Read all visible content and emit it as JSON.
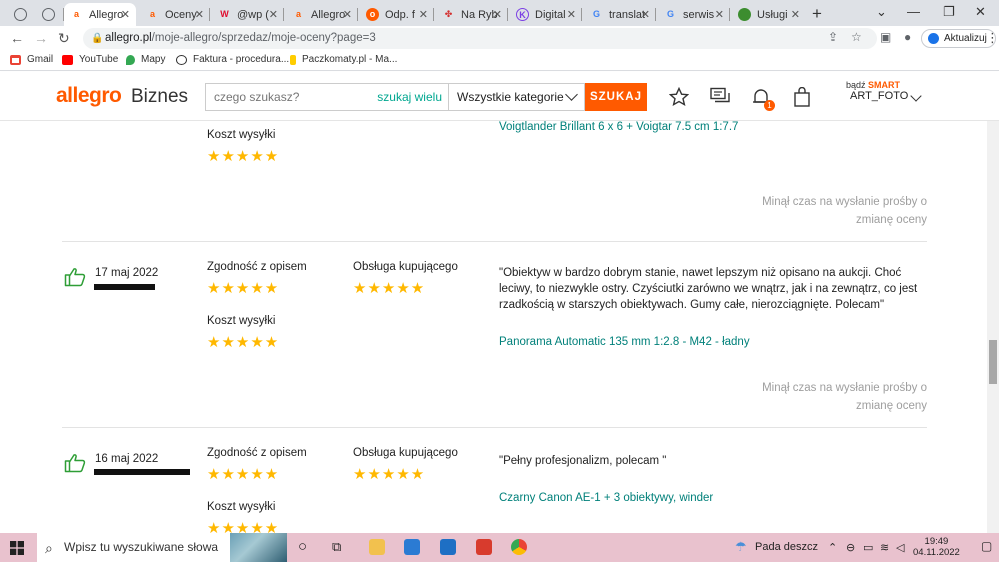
{
  "browser": {
    "tabs": [
      {
        "label": "",
        "icon": "chrome-icon",
        "color": "#5f6368"
      },
      {
        "label": "",
        "icon": "chrome-icon",
        "color": "#5f6368"
      },
      {
        "label": "Allegro",
        "icon": "allegro-icon",
        "color": "#ff5a00",
        "active": true
      },
      {
        "label": "Oceny",
        "icon": "allegro-icon",
        "color": "#ff5a00"
      },
      {
        "label": "@wp (",
        "icon": "wp-icon",
        "color": "#e10d2f"
      },
      {
        "label": "Allegro",
        "icon": "allegro-icon",
        "color": "#ff5a00"
      },
      {
        "label": "Odp. f",
        "icon": "odp-icon",
        "color": "#ff5a00"
      },
      {
        "label": "Na Ryb",
        "icon": "fish-icon",
        "color": "#d32f2f"
      },
      {
        "label": "Digital",
        "icon": "k-icon",
        "color": "#7b3fe4"
      },
      {
        "label": "translat",
        "icon": "google-icon",
        "color": "#4285f4"
      },
      {
        "label": "serwis",
        "icon": "google-icon",
        "color": "#4285f4"
      },
      {
        "label": "Usługi",
        "icon": "leaf-icon",
        "color": "#3c8d2f"
      }
    ],
    "url_host": "allegro.pl",
    "url_path": "/moje-allegro/sprzedaz/moje-oceny?page=3",
    "update_label": "Aktualizuj",
    "bookmarks": [
      {
        "label": "Gmail",
        "color": "#ea4335"
      },
      {
        "label": "YouTube",
        "color": "#ff0000"
      },
      {
        "label": "Mapy",
        "color": "#34a853"
      },
      {
        "label": "Faktura - procedura...",
        "color": "#333333"
      },
      {
        "label": "Paczkomaty.pl - Ma...",
        "color": "#ffcd00"
      }
    ]
  },
  "header": {
    "logo": "allegro",
    "logo_suffix": "Biznes",
    "search_placeholder": "czego szukasz?",
    "search_many": "szukaj wielu",
    "category": "Wszystkie kategorie",
    "search_button": "SZUKAJ",
    "notification_count": "1",
    "smart_prefix": "bądź",
    "smart_label": "SMART",
    "username": "ART_FOTO"
  },
  "labels": {
    "zgodnosc": "Zgodność z opisem",
    "obsluga": "Obsługa kupującego",
    "koszt": "Koszt wysyłki",
    "expired": "Minął czas na wysłanie prośby o zmianę oceny",
    "stars": "★★★★★"
  },
  "reviews": [
    {
      "date": "",
      "comment": "",
      "offer": "Voigtlander Brillant 6 x 6 + Voigtar 7.5 cm 1:7.7",
      "rating_delivery": 5
    },
    {
      "date": "17 maj 2022",
      "comment": "\"Obiektyw w bardzo dobrym stanie, nawet lepszym niż opisano na aukcji. Choć leciwy, to niezwykle ostry. Czyściutki zarówno we wnątrz, jak i na zewnątrz, co jest rzadkością w starszych obiektywach. Gumy całe, nierozciągnięte. Polecam\"",
      "offer": "Panorama Automatic 135 mm 1:2.8 - M42 - ładny",
      "rating_description": 5,
      "rating_service": 5,
      "rating_delivery": 5
    },
    {
      "date": "16 maj 2022",
      "comment": "\"Pełny profesjonalizm, polecam \"",
      "offer": "Czarny Canon AE-1 + 3 obiektywy, winder",
      "rating_description": 5,
      "rating_service": 5,
      "rating_delivery": 5
    }
  ],
  "taskbar": {
    "search_placeholder": "Wpisz tu wyszukiwane słowa",
    "weather": "Pada deszcz",
    "time": "19:49",
    "date": "04.11.2022"
  }
}
